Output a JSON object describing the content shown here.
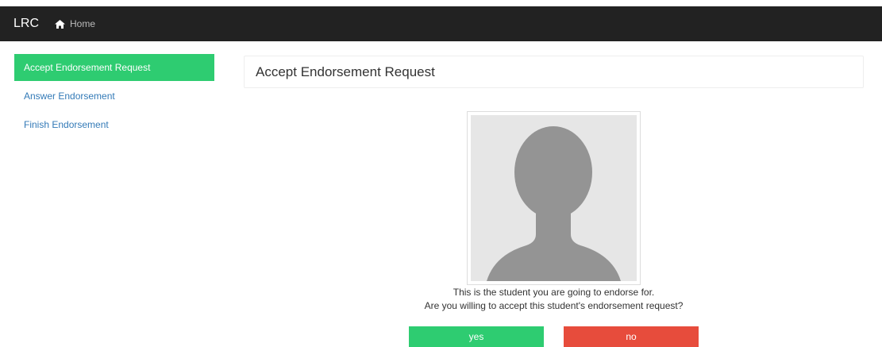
{
  "navbar": {
    "brand": "LRC",
    "home_label": "Home",
    "home_icon": "home-icon",
    "background": "#222222"
  },
  "sidebar": {
    "items": [
      {
        "label": "Accept Endorsement Request",
        "active": true
      },
      {
        "label": "Answer Endorsement",
        "active": false
      },
      {
        "label": "Finish Endorsement",
        "active": false
      }
    ],
    "active_color": "#2ecc71",
    "link_color": "#337ab7"
  },
  "main": {
    "heading": "Accept Endorsement Request",
    "avatar_icon": "user-silhouette-icon",
    "caption_line1": "This is the student you are going to endorse for.",
    "caption_line2": "Are you willing to accept this student's endorsement request?",
    "yes_label": "yes",
    "no_label": "no",
    "yes_color": "#2ecc71",
    "no_color": "#e74c3c"
  }
}
